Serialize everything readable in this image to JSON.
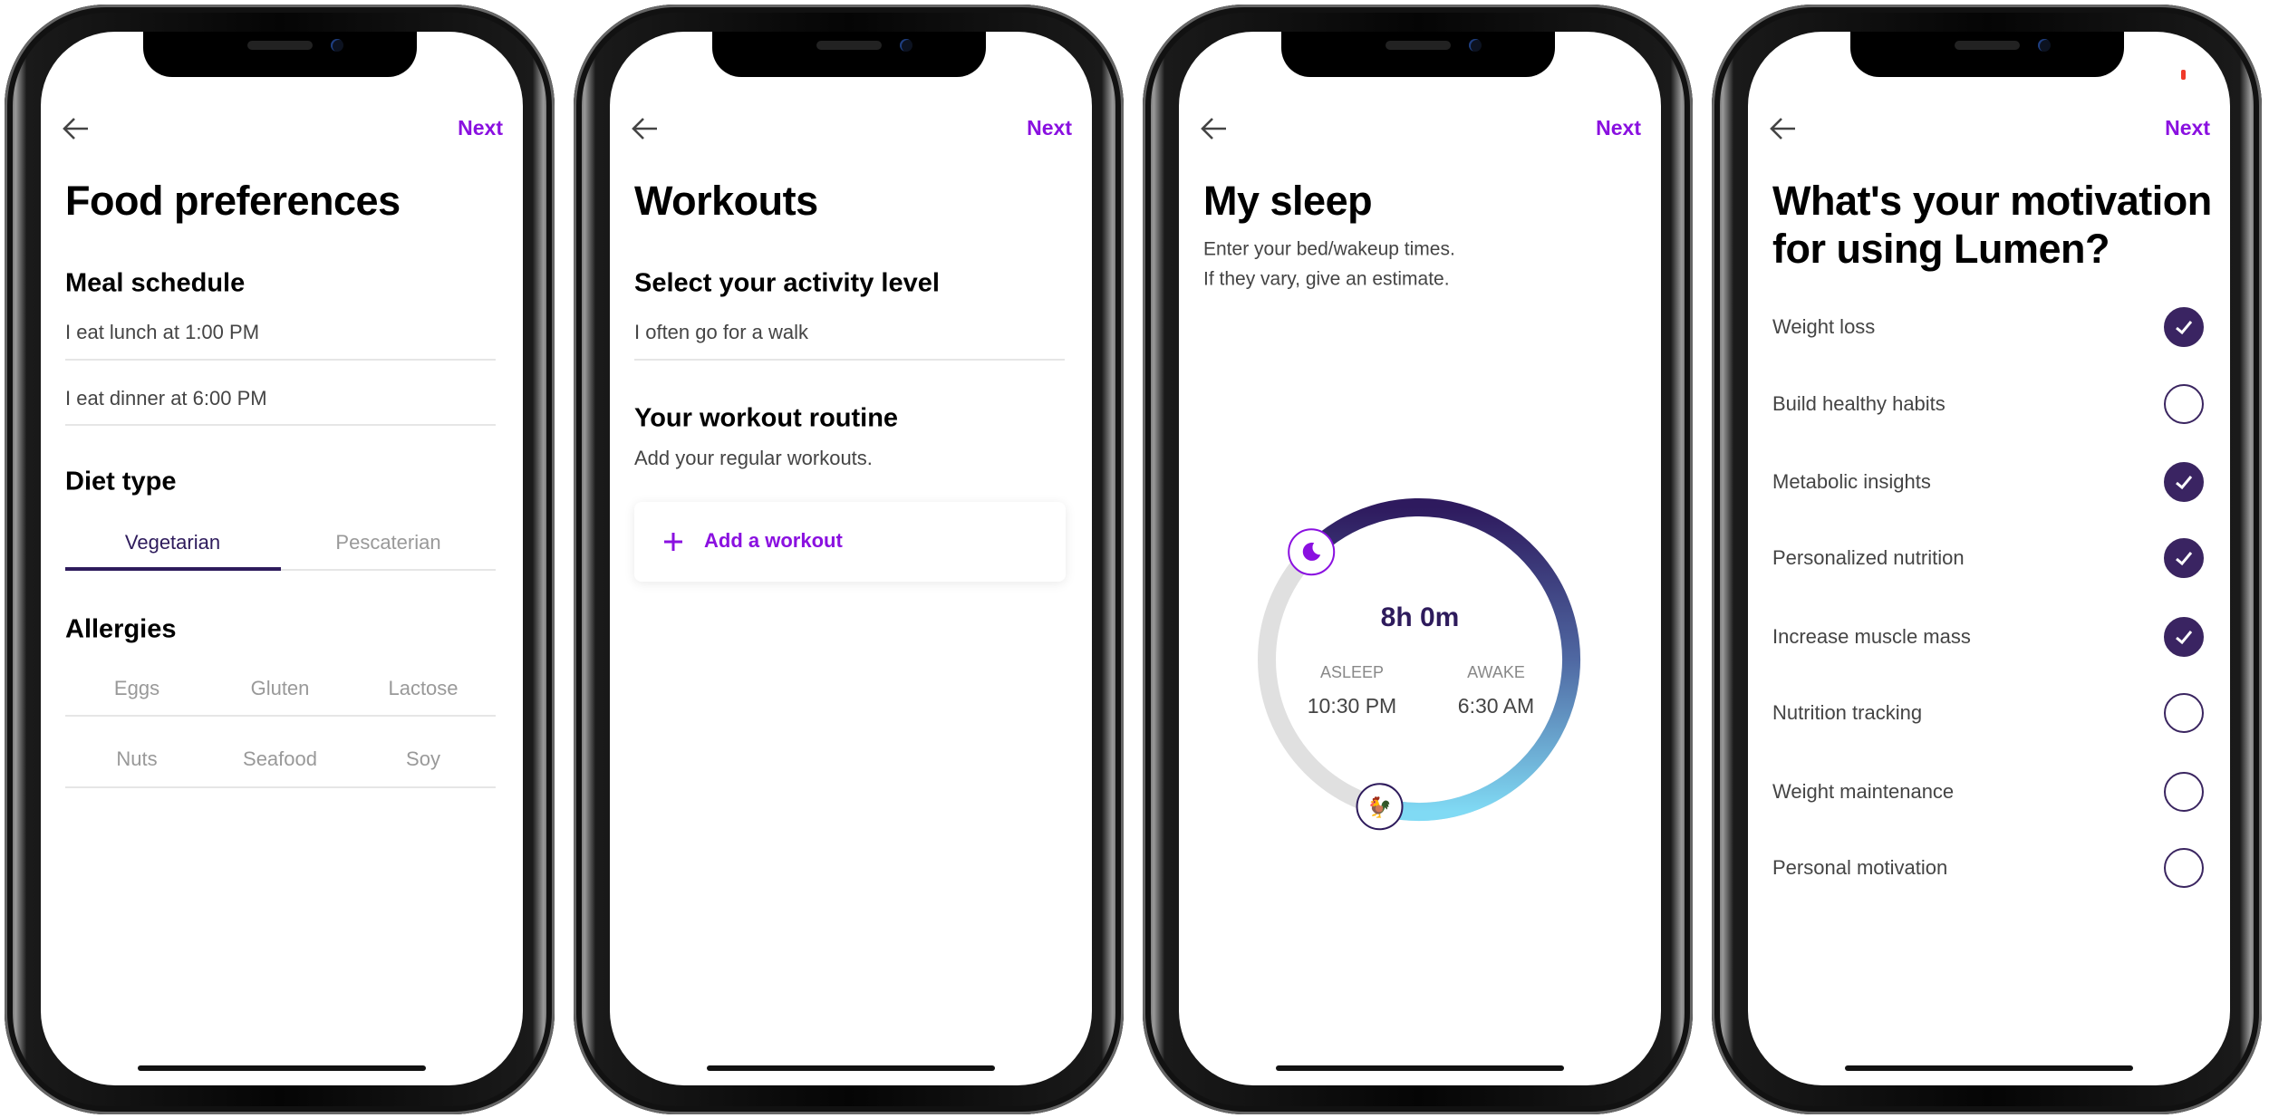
{
  "colors": {
    "accent": "#8a10e0",
    "dark": "#2e1b5c",
    "ring_start": "#2e1a5e",
    "ring_end": "#80daf4",
    "ring_track": "#e0e0e0",
    "checked": "#3a2462"
  },
  "nav": {
    "back_icon": "arrow-left-icon",
    "next_label": "Next"
  },
  "food": {
    "title": "Food preferences",
    "meal_heading": "Meal schedule",
    "meals": [
      "I eat lunch at 1:00 PM",
      "I eat dinner at 6:00 PM"
    ],
    "diet_heading": "Diet type",
    "diet_tabs": [
      {
        "label": "Vegetarian",
        "selected": true
      },
      {
        "label": "Pescaterian",
        "selected": false
      }
    ],
    "allergies_heading": "Allergies",
    "allergies": [
      "Eggs",
      "Gluten",
      "Lactose",
      "Nuts",
      "Seafood",
      "Soy"
    ]
  },
  "workouts": {
    "title": "Workouts",
    "activity_heading": "Select your activity level",
    "activity_value": "I often go for a walk",
    "routine_heading": "Your workout routine",
    "routine_sub": "Add your regular workouts.",
    "add_label": "Add a workout",
    "add_icon": "plus-icon"
  },
  "sleep": {
    "title": "My sleep",
    "subtitle": [
      "Enter your bed/wakeup times.",
      "If they vary, give an estimate."
    ],
    "duration": "8h 0m",
    "asleep_label": "ASLEEP",
    "asleep_time": "10:30 PM",
    "awake_label": "AWAKE",
    "awake_time": "6:30 AM",
    "bed_hour": 22.5,
    "wake_hour": 6.5,
    "bed_icon": "moon-icon",
    "wake_icon": "rooster-icon"
  },
  "motivation": {
    "title": [
      "What's your motivation",
      "for using Lumen?"
    ],
    "options": [
      {
        "label": "Weight loss",
        "checked": true
      },
      {
        "label": "Build healthy habits",
        "checked": false
      },
      {
        "label": "Metabolic insights",
        "checked": true
      },
      {
        "label": "Personalized nutrition",
        "checked": true
      },
      {
        "label": "Increase muscle mass",
        "checked": true
      },
      {
        "label": "Nutrition tracking",
        "checked": false
      },
      {
        "label": "Weight maintenance",
        "checked": false
      },
      {
        "label": "Personal motivation",
        "checked": false
      }
    ]
  }
}
